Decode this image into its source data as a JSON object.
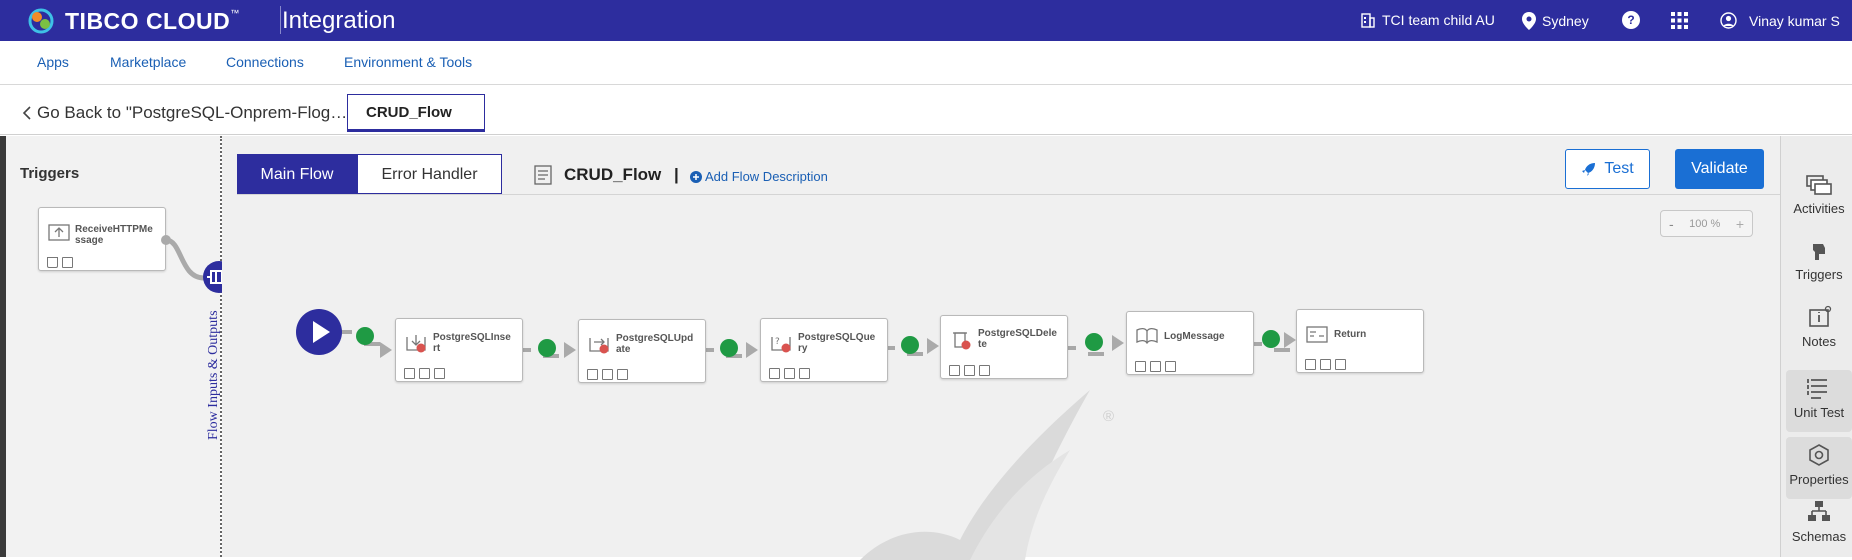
{
  "header": {
    "brand": "TIBCO CLOUD",
    "brand_tm": "™",
    "app_title": "Integration",
    "org": "TCI team child AU",
    "region": "Sydney",
    "help": "?",
    "user": "Vinay kumar S"
  },
  "nav": {
    "items": [
      "Apps",
      "Marketplace",
      "Connections",
      "Environment & Tools"
    ]
  },
  "crumb": {
    "go_back": "Go Back to \"PostgreSQL-Onprem-Flog… \"",
    "flow_tab": "CRUD_Flow"
  },
  "triggers": {
    "title": "Triggers",
    "tile_label": "ReceiveHTTPMessage"
  },
  "flow_io_label": "Flow Inputs & Outputs",
  "toolbar": {
    "main_flow": "Main Flow",
    "error_handler": "Error Handler",
    "flow_name": "CRUD_Flow",
    "flow_sep": "|",
    "add_desc": "Add Flow Description",
    "test": "Test",
    "validate": "Validate",
    "zoom_minus": "-",
    "zoom_level": "100 %",
    "zoom_plus": "+"
  },
  "activities": [
    {
      "label": "PostgreSQLInsert"
    },
    {
      "label": "PostgreSQLUpdate"
    },
    {
      "label": "PostgreSQLQuery"
    },
    {
      "label": "PostgreSQLDelete"
    },
    {
      "label": "LogMessage"
    },
    {
      "label": "Return"
    }
  ],
  "sidebar": {
    "items": [
      "Activities",
      "Triggers",
      "Notes",
      "Unit Test",
      "Properties",
      "Schemas"
    ]
  },
  "watermark_mark": "®",
  "colors": {
    "brand": "#2d2d9e",
    "accent": "#1a6fd4",
    "success": "#1f9a44",
    "error_badge": "#d9534f"
  }
}
